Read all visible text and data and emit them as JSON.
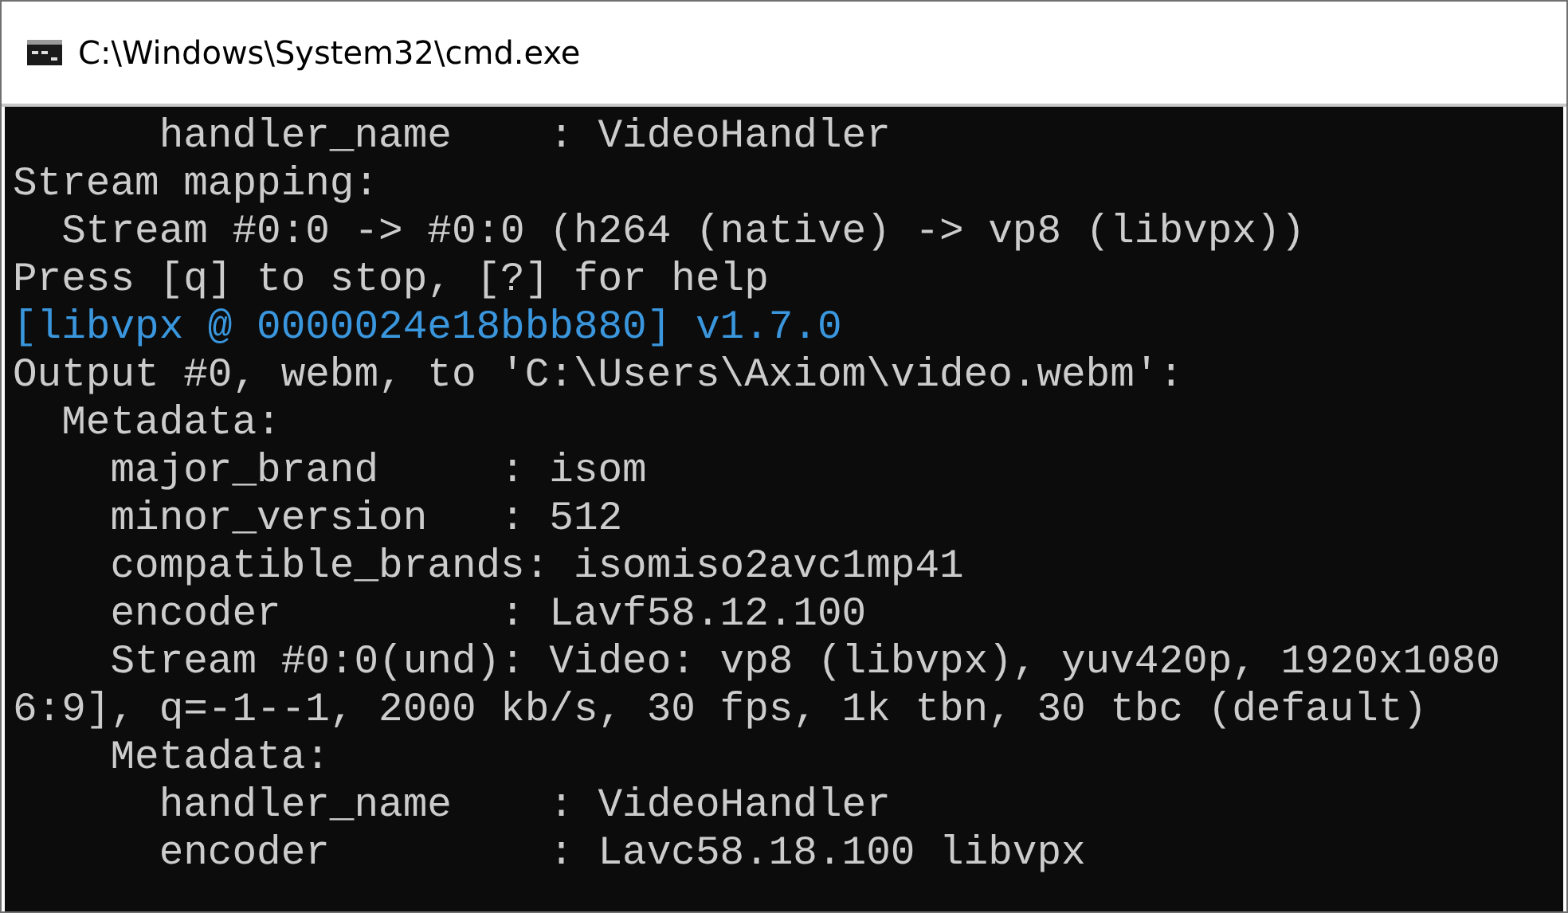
{
  "window": {
    "title": "C:\\Windows\\System32\\cmd.exe"
  },
  "console": {
    "lines": [
      {
        "kind": "normal",
        "text": "      handler_name    : VideoHandler"
      },
      {
        "kind": "normal",
        "text": "Stream mapping:"
      },
      {
        "kind": "normal",
        "text": "  Stream #0:0 -> #0:0 (h264 (native) -> vp8 (libvpx))"
      },
      {
        "kind": "normal",
        "text": "Press [q] to stop, [?] for help"
      },
      {
        "kind": "highlight",
        "text": "[libvpx @ 0000024e18bbb880] v1.7.0"
      },
      {
        "kind": "normal",
        "text": "Output #0, webm, to 'C:\\Users\\Axiom\\video.webm':"
      },
      {
        "kind": "normal",
        "text": "  Metadata:"
      },
      {
        "kind": "normal",
        "text": "    major_brand     : isom"
      },
      {
        "kind": "normal",
        "text": "    minor_version   : 512"
      },
      {
        "kind": "normal",
        "text": "    compatible_brands: isomiso2avc1mp41"
      },
      {
        "kind": "normal",
        "text": "    encoder         : Lavf58.12.100"
      },
      {
        "kind": "normal",
        "text": "    Stream #0:0(und): Video: vp8 (libvpx), yuv420p, 1920x1080"
      },
      {
        "kind": "normal",
        "text": "6:9], q=-1--1, 2000 kb/s, 30 fps, 1k tbn, 30 tbc (default)"
      },
      {
        "kind": "normal",
        "text": "    Metadata:"
      },
      {
        "kind": "normal",
        "text": "      handler_name    : VideoHandler"
      },
      {
        "kind": "normal",
        "text": "      encoder         : Lavc58.18.100 libvpx"
      }
    ]
  }
}
